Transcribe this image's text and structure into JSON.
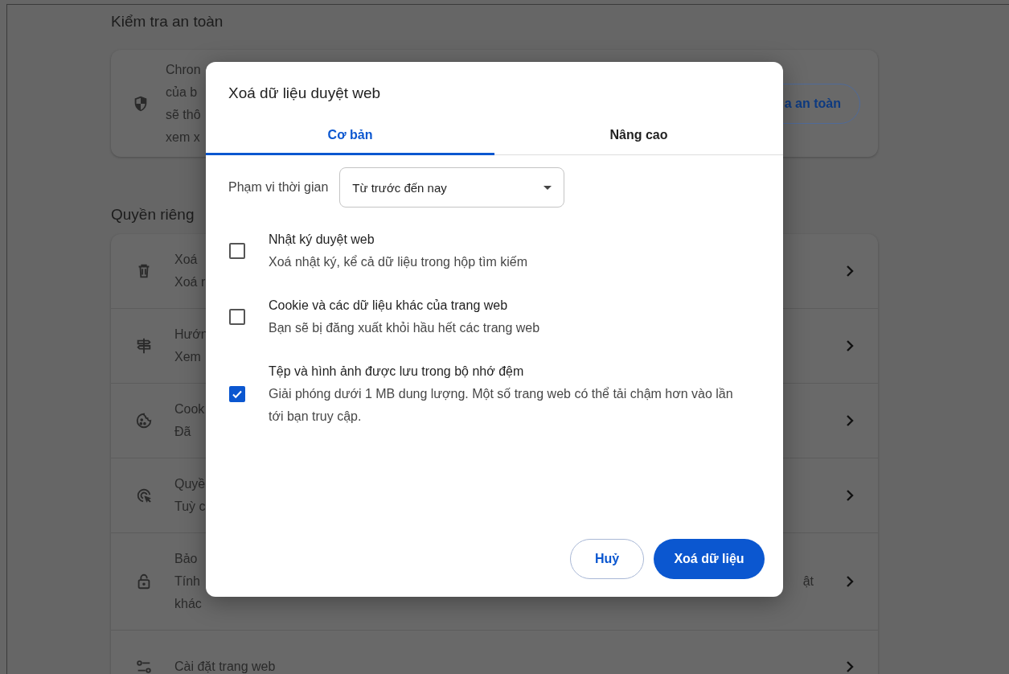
{
  "safety": {
    "heading": "Kiểm tra an toàn",
    "card_lines": [
      "Chron",
      "của b",
      "sẽ thô",
      "xem x"
    ],
    "button": "a an toàn"
  },
  "privacy": {
    "heading": "Quyền riêng",
    "rows": [
      {
        "lines": [
          "Xoá",
          "Xoá r"
        ]
      },
      {
        "lines": [
          "Hướn",
          "Xem"
        ]
      },
      {
        "lines": [
          "Cook",
          "Đã"
        ]
      },
      {
        "lines": [
          "Quyề",
          "Tuỳ c"
        ]
      },
      {
        "lines": [
          "Bảo",
          "Tính",
          "khác"
        ],
        "tail": "ật"
      },
      {
        "lines": [
          "Cài đặt trang web"
        ]
      }
    ]
  },
  "dialog": {
    "title": "Xoá dữ liệu duyệt web",
    "tabs": [
      {
        "label": "Cơ bản",
        "selected": true
      },
      {
        "label": "Nâng cao",
        "selected": false
      }
    ],
    "time_range": {
      "label": "Phạm vi thời gian",
      "value": "Từ trước đến nay"
    },
    "options": [
      {
        "title": "Nhật ký duyệt web",
        "description": "Xoá nhật ký, kể cả dữ liệu trong hộp tìm kiếm",
        "checked": false
      },
      {
        "title": "Cookie và các dữ liệu khác của trang web",
        "description": "Bạn sẽ bị đăng xuất khỏi hầu hết các trang web",
        "checked": false
      },
      {
        "title": "Tệp và hình ảnh được lưu trong bộ nhớ đệm",
        "description": "Giải phóng dưới 1 MB dung lượng. Một số trang web có thể tải chậm hơn vào lần tới bạn truy cập.",
        "checked": true
      }
    ],
    "buttons": {
      "cancel": "Huỷ",
      "confirm": "Xoá dữ liệu"
    }
  }
}
